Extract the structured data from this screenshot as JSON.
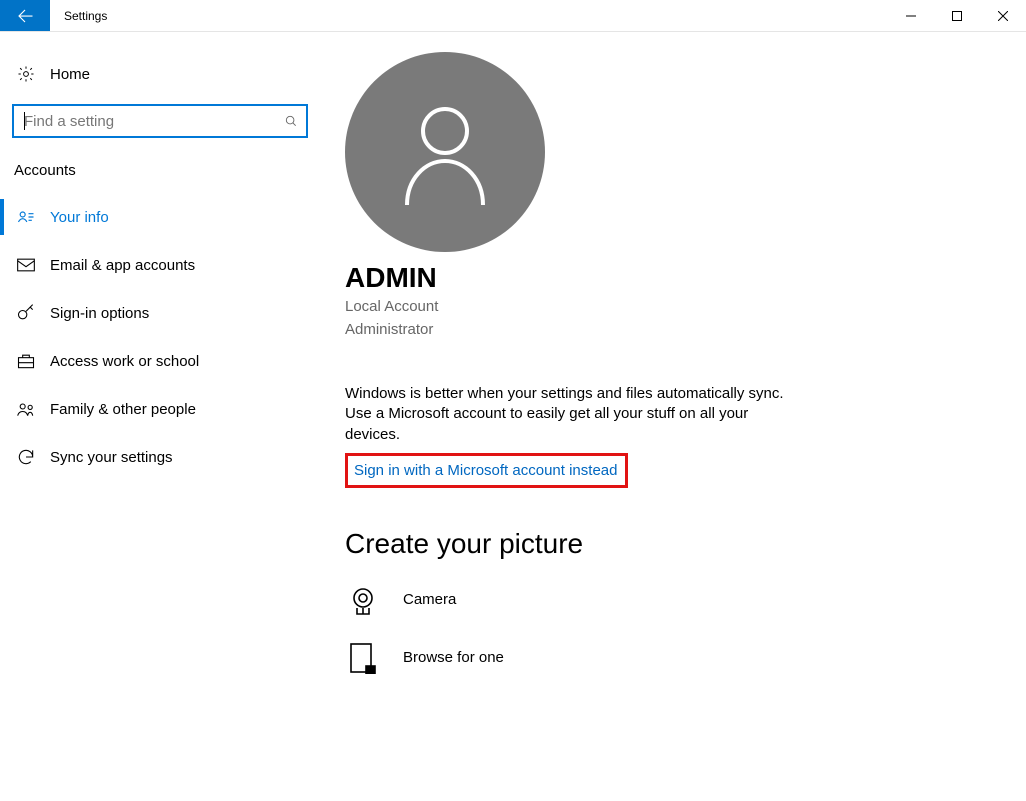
{
  "window": {
    "title": "Settings"
  },
  "sidebar": {
    "home_label": "Home",
    "search_placeholder": "Find a setting",
    "category": "Accounts",
    "items": [
      {
        "label": "Your info"
      },
      {
        "label": "Email & app accounts"
      },
      {
        "label": "Sign-in options"
      },
      {
        "label": "Access work or school"
      },
      {
        "label": "Family & other people"
      },
      {
        "label": "Sync your settings"
      }
    ]
  },
  "account": {
    "name": "ADMIN",
    "type": "Local Account",
    "role": "Administrator",
    "sync_blurb": "Windows is better when your settings and files automatically sync. Use a Microsoft account to easily get all your stuff on all your devices.",
    "signin_link": "Sign in with a Microsoft account instead"
  },
  "picture": {
    "heading": "Create your picture",
    "camera": "Camera",
    "browse": "Browse for one"
  }
}
